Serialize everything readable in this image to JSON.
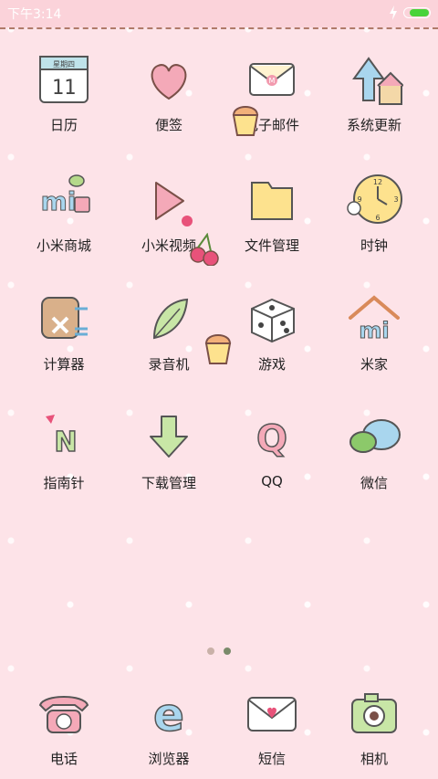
{
  "status": {
    "time": "下午3:14",
    "battery_level": 0.75
  },
  "apps": [
    {
      "label": "日历",
      "icon": "calendar-icon",
      "calendar_weekday": "星期四",
      "calendar_day": "11"
    },
    {
      "label": "便签",
      "icon": "heart-notes-icon"
    },
    {
      "label": "电子邮件",
      "icon": "envelope-mail-icon",
      "letter": "M"
    },
    {
      "label": "系统更新",
      "icon": "update-arrow-icon"
    },
    {
      "label": "小米商城",
      "icon": "mi-store-icon",
      "letter": "mi"
    },
    {
      "label": "小米视频",
      "icon": "play-video-icon"
    },
    {
      "label": "文件管理",
      "icon": "folder-icon"
    },
    {
      "label": "时钟",
      "icon": "clock-icon",
      "numbers": [
        "12",
        "3",
        "6",
        "9"
      ]
    },
    {
      "label": "计算器",
      "icon": "calculator-icon"
    },
    {
      "label": "录音机",
      "icon": "leaf-recorder-icon"
    },
    {
      "label": "游戏",
      "icon": "dice-icon"
    },
    {
      "label": "米家",
      "icon": "mi-home-icon",
      "letter": "mi"
    },
    {
      "label": "指南针",
      "icon": "compass-icon",
      "letter": "N"
    },
    {
      "label": "下载管理",
      "icon": "download-arrow-icon"
    },
    {
      "label": "QQ",
      "icon": "qq-icon",
      "letter": "Q"
    },
    {
      "label": "微信",
      "icon": "wechat-bubbles-icon"
    }
  ],
  "page_indicator": {
    "pages": 2,
    "current": 2
  },
  "dock": [
    {
      "label": "电话",
      "icon": "telephone-icon"
    },
    {
      "label": "浏览器",
      "icon": "browser-e-icon",
      "letter": "e"
    },
    {
      "label": "短信",
      "icon": "message-envelope-icon"
    },
    {
      "label": "相机",
      "icon": "camera-icon"
    }
  ]
}
